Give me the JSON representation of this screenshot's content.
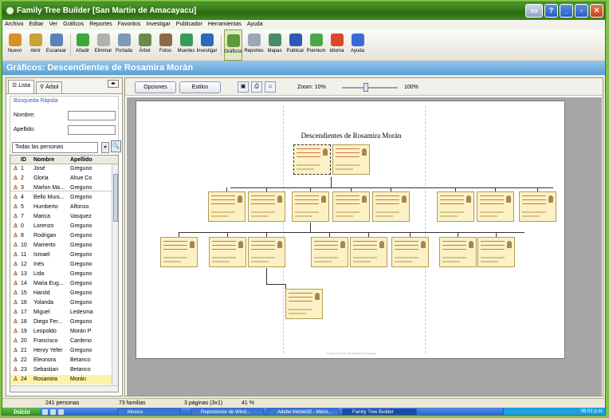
{
  "window": {
    "title": "Family Tree Builder [San Martin de Amacayacu]"
  },
  "menu": [
    "Archivo",
    "Editar",
    "Ver",
    "Gráficos",
    "Reportes",
    "Favoritos",
    "Investigar",
    "Publicador",
    "Herramientas",
    "Ayuda"
  ],
  "toolbar": [
    {
      "label": "Nuevo",
      "icon": "new-file-icon",
      "color": "#d9902a"
    },
    {
      "label": "Abrir",
      "icon": "open-folder-icon",
      "color": "#c9a23a"
    },
    {
      "label": "Escanear",
      "icon": "scanner-icon",
      "color": "#5b82b8"
    },
    {
      "label": "Añadir",
      "icon": "add-icon",
      "color": "#3aa83a"
    },
    {
      "label": "Eliminar",
      "icon": "delete-icon",
      "color": "#b0b0b0"
    },
    {
      "label": "Portada",
      "icon": "home-icon",
      "color": "#7a9ab8"
    },
    {
      "label": "Árbol",
      "icon": "tree-icon",
      "color": "#6a8a4a"
    },
    {
      "label": "Fotos",
      "icon": "photos-icon",
      "color": "#8a6a4a"
    },
    {
      "label": "Muertes",
      "icon": "globe-icon",
      "color": "#3a9a5a"
    },
    {
      "label": "Investigar",
      "icon": "research-icon",
      "color": "#2a6ab8"
    },
    {
      "label": "Gráficos",
      "icon": "charts-icon",
      "color": "#5a9a3a"
    },
    {
      "label": "Reportes",
      "icon": "reports-icon",
      "color": "#9aa8b8"
    },
    {
      "label": "Mapas",
      "icon": "maps-icon",
      "color": "#4a8a6a"
    },
    {
      "label": "Publicar",
      "icon": "publish-icon",
      "color": "#2a5ab8"
    },
    {
      "label": "Premium",
      "icon": "premium-icon",
      "color": "#4aa84a"
    },
    {
      "label": "Idioma",
      "icon": "flag-icon",
      "color": "#d84a2a"
    },
    {
      "label": "Ayuda",
      "icon": "help-icon",
      "color": "#3a6ad8"
    }
  ],
  "header": {
    "title": "Gráficos: Descendientes de Rosamira Morán"
  },
  "left_panel": {
    "tabs": [
      "Lista",
      "Árbol"
    ],
    "quick_search": {
      "title": "Búsqueda Rápida",
      "name_label": "Nombre:",
      "surname_label": "Apellido:",
      "filter": "Todas las personas"
    },
    "columns": [
      "ID",
      "Nombre",
      "Apellido"
    ],
    "rows": [
      {
        "id": "1",
        "name": "José",
        "surname": "Greguno"
      },
      {
        "id": "2",
        "name": "Gloria",
        "surname": "Ahue Co"
      },
      {
        "id": "3",
        "name": "Marlon Ma...",
        "surname": "Greguno"
      },
      {
        "id": "4",
        "name": "Bello Muni...",
        "surname": "Gregorio"
      },
      {
        "id": "5",
        "name": "Humberto",
        "surname": "Alfonso"
      },
      {
        "id": "7",
        "name": "Marica",
        "surname": "Vasquez"
      },
      {
        "id": "0",
        "name": "Lorenzo",
        "surname": "Greguno"
      },
      {
        "id": "8",
        "name": "Rodrigan",
        "surname": "Greguno"
      },
      {
        "id": "10",
        "name": "Mamerto",
        "surname": "Greguno"
      },
      {
        "id": "11",
        "name": "Ismael",
        "surname": "Greguno"
      },
      {
        "id": "12",
        "name": "Inés",
        "surname": "Greguno"
      },
      {
        "id": "13",
        "name": "Lida",
        "surname": "Greguno"
      },
      {
        "id": "14",
        "name": "Maria Eug...",
        "surname": "Greguno"
      },
      {
        "id": "15",
        "name": "Harold",
        "surname": "Greguno"
      },
      {
        "id": "16",
        "name": "Yolanda",
        "surname": "Greguno"
      },
      {
        "id": "17",
        "name": "Miguel",
        "surname": "Ledesma"
      },
      {
        "id": "18",
        "name": "Diego Fer...",
        "surname": "Greguno"
      },
      {
        "id": "19",
        "name": "Leopoldo",
        "surname": "Morán P"
      },
      {
        "id": "20",
        "name": "Francisco",
        "surname": "Cardeno"
      },
      {
        "id": "21",
        "name": "Henry Yefer",
        "surname": "Greguno"
      },
      {
        "id": "22",
        "name": "Eleonora",
        "surname": "Betanco"
      },
      {
        "id": "23",
        "name": "Sebastian",
        "surname": "Betanco"
      },
      {
        "id": "24",
        "name": "Rosamira",
        "surname": "Morán"
      },
      {
        "id": "25",
        "name": "Roberto",
        "surname": "Betanco"
      },
      {
        "id": "26",
        "name": "Nicasio",
        "surname": "Betanco"
      }
    ],
    "selected_id": "24"
  },
  "chart_toolbar": {
    "options": "Opciones",
    "styles": "Estilos",
    "zoom_label": "Zoom: 10%",
    "zoom_max": "100%"
  },
  "chart": {
    "title": "Descendientes de Rosamira Morán",
    "footer": "Creado con Family Tree Builder de MyHeritage"
  },
  "status": {
    "persons": "241 personas",
    "families": "73 familias",
    "pages": "3 páginas (3x1)",
    "zoom": "41 %"
  },
  "taskbar": {
    "start": "Inicio",
    "tasks": [
      "Musica",
      "Reproductor de Wind...",
      "Adobe Mobiel32 - Micro...",
      "Family Tree Builder"
    ],
    "clock": "06:01 p.m."
  }
}
